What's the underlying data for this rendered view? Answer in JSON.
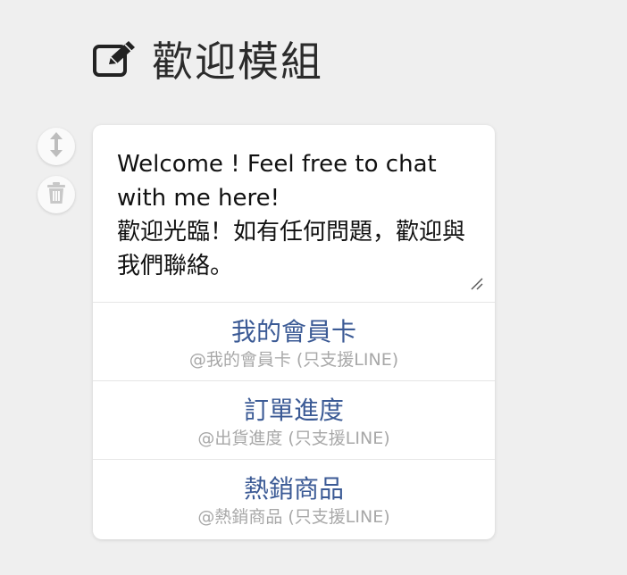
{
  "header": {
    "icon": "edit-icon",
    "title": "歡迎模組"
  },
  "side_buttons": {
    "move_icon": "vertical-resize-icon",
    "delete_icon": "trash-icon"
  },
  "message": {
    "text": "Welcome ! Feel free to chat with me here!\n歡迎光臨！如有任何問題，歡迎與我們聯絡。"
  },
  "actions": [
    {
      "label": "我的會員卡",
      "sub": "@我的會員卡 (只支援LINE)"
    },
    {
      "label": "訂單進度",
      "sub": "@出貨進度 (只支援LINE)"
    },
    {
      "label": "熱銷商品",
      "sub": "@熱銷商品 (只支援LINE)"
    }
  ]
}
